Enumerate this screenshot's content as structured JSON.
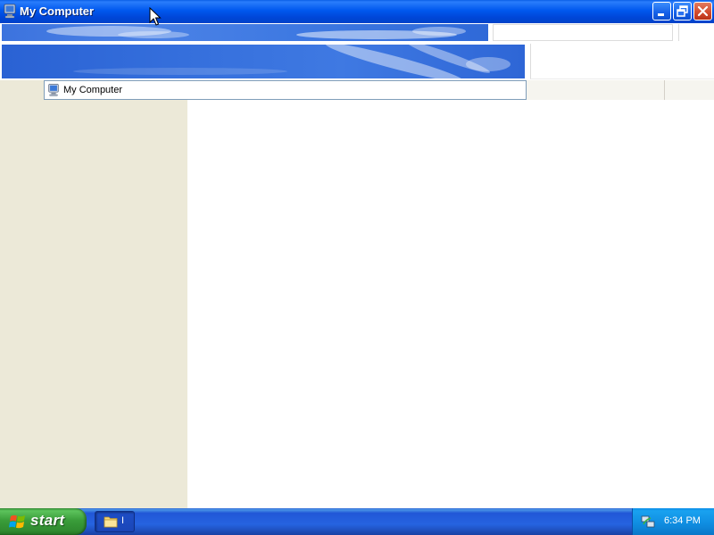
{
  "window": {
    "title": "My Computer",
    "controls": [
      "minimize",
      "restore",
      "close"
    ]
  },
  "address_bar": {
    "value": "My Computer",
    "icon": "computer-icon"
  },
  "taskbar": {
    "start_label": "start",
    "task_button_label": "I",
    "clock": "6:34 PM"
  },
  "colors": {
    "titlebar": "#0058ee",
    "taskpane": "#ece9d8",
    "taskbar": "#2663e0",
    "start": "#3a9d3a",
    "tray": "#0f8ce0"
  }
}
